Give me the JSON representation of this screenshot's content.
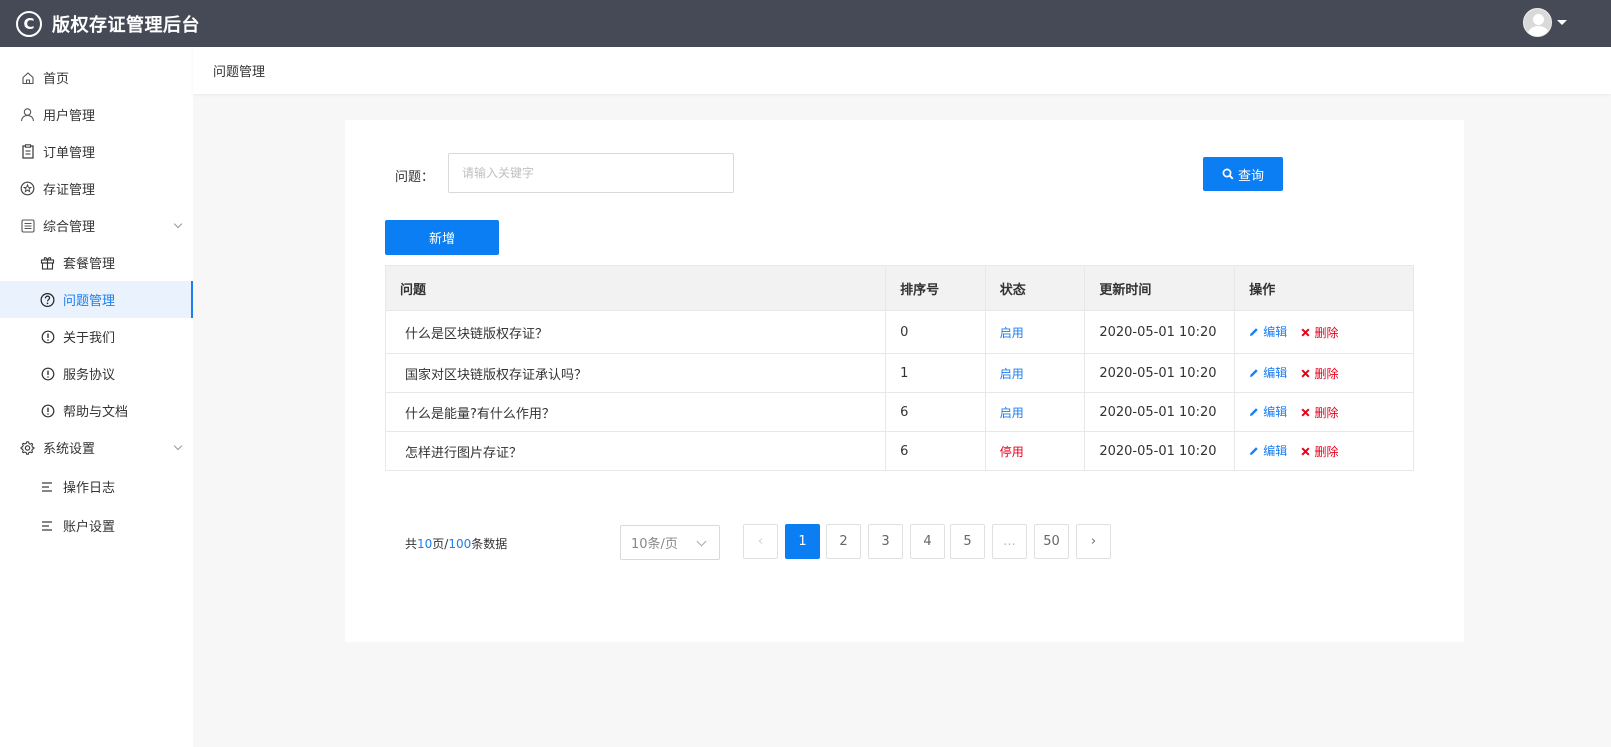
{
  "app": {
    "title": "版权存证管理后台",
    "logo_glyph": "C"
  },
  "sidebar": {
    "items": [
      {
        "label": "首页",
        "icon": "home-icon"
      },
      {
        "label": "用户管理",
        "icon": "user-icon"
      },
      {
        "label": "订单管理",
        "icon": "clipboard-icon"
      },
      {
        "label": "存证管理",
        "icon": "star-circle-icon"
      },
      {
        "label": "综合管理",
        "icon": "list-box-icon"
      },
      {
        "label": "套餐管理",
        "icon": "gift-icon"
      },
      {
        "label": "问题管理",
        "icon": "question-circle-icon"
      },
      {
        "label": "关于我们",
        "icon": "exclamation-circle-icon"
      },
      {
        "label": "服务协议",
        "icon": "exclamation-circle-icon"
      },
      {
        "label": "帮助与文档",
        "icon": "exclamation-circle-icon"
      },
      {
        "label": "系统设置",
        "icon": "gear-icon"
      },
      {
        "label": "操作日志",
        "icon": "lines-icon"
      },
      {
        "label": "账户设置",
        "icon": "lines-icon"
      }
    ]
  },
  "breadcrumb": {
    "current": "问题管理"
  },
  "search": {
    "label": "问题：",
    "placeholder": "请输入关键字",
    "value": "",
    "query_label": "查询"
  },
  "toolbar": {
    "add_label": "新增"
  },
  "table": {
    "headers": {
      "question": "问题",
      "order": "排序号",
      "status": "状态",
      "updated": "更新时间",
      "actions": "操作"
    },
    "rows": [
      {
        "question": "什么是区块链版权存证？",
        "order": "0",
        "status": "启用",
        "updated": "2020-05-01 10:20",
        "edit": "编辑",
        "del": "删除"
      },
      {
        "question": "国家对区块链版权存证承认吗？",
        "order": "1",
        "status": "启用",
        "updated": "2020-05-01 10:20",
        "edit": "编辑",
        "del": "删除"
      },
      {
        "question": "什么是能量?有什么作用？",
        "order": "6",
        "status": "启用",
        "updated": "2020-05-01 10:20",
        "edit": "编辑",
        "del": "删除"
      },
      {
        "question": "怎样进行图片存证？",
        "order": "6",
        "status": "停用",
        "updated": "2020-05-01 10:20",
        "edit": "编辑",
        "del": "删除"
      }
    ]
  },
  "pagination": {
    "total_prefix": "共",
    "total_pages": "10",
    "total_mid": "页/",
    "total_items": "100",
    "total_suffix": "条数据",
    "page_size": "10条/页",
    "prev": "‹",
    "next": "›",
    "pages": [
      "1",
      "2",
      "3",
      "4",
      "5",
      "...",
      "50"
    ],
    "current": "1"
  },
  "colors": {
    "header_bg": "#464a57",
    "accent": "#0a7ef2",
    "danger": "#e8001c"
  }
}
